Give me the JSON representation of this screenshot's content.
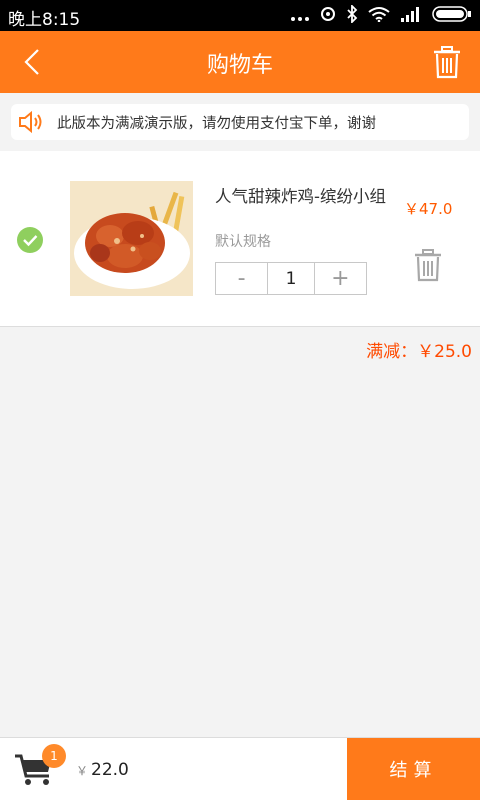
{
  "status_bar": {
    "time": "晚上8:15"
  },
  "header": {
    "title": "购物车"
  },
  "notice": {
    "text": "此版本为满减演示版，请勿使用支付宝下单，谢谢"
  },
  "cart_item": {
    "name": "人气甜辣炸鸡-缤纷小组",
    "price": "￥47.0",
    "spec": "默认规格",
    "minus": "-",
    "plus": "+",
    "quantity": "1",
    "checked": true
  },
  "discount": {
    "text": "满减：￥25.0"
  },
  "bottom_bar": {
    "badge_count": "1",
    "yen": "￥",
    "total": "22.0",
    "checkout_label": "结算"
  },
  "colors": {
    "accent": "#ff7a1a",
    "price": "#ff5a00",
    "check": "#8fcf5e"
  }
}
